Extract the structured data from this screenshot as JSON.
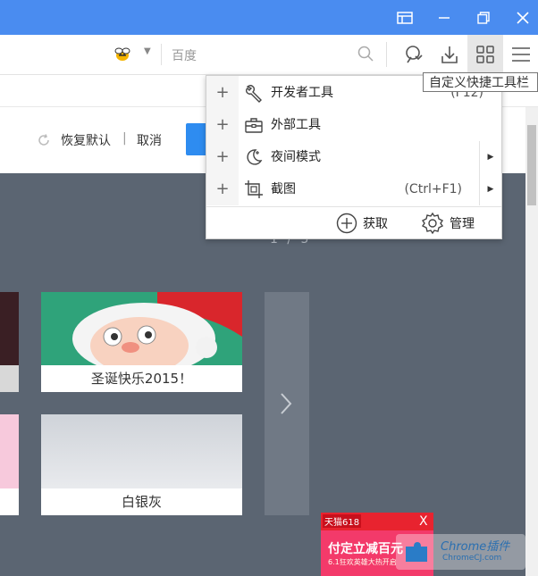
{
  "colors": {
    "titlebar": "#4a8cf0",
    "page_bg": "#5b6572",
    "accent_button": "#2e8cf0",
    "ad_red": "#e8232f"
  },
  "search": {
    "placeholder": "百度"
  },
  "toolbar": {
    "customize_tooltip": "自定义快捷工具栏"
  },
  "settings_panel": {
    "restore_default": "恢复默认",
    "separator": "|",
    "cancel": "取消"
  },
  "gallery": {
    "pager": "1 / 5",
    "themes": [
      {
        "caption": "圣诞快乐2015！"
      },
      {
        "caption": "白银灰"
      }
    ]
  },
  "menu": {
    "items": [
      {
        "label": "开发者工具",
        "shortcut": "(F12)",
        "icon": "wrench-icon",
        "submenu": false
      },
      {
        "label": "外部工具",
        "shortcut": "",
        "icon": "toolbox-icon",
        "submenu": false
      },
      {
        "label": "夜间模式",
        "shortcut": "",
        "icon": "moon-icon",
        "submenu": true
      },
      {
        "label": "截图",
        "shortcut": "(Ctrl+F1)",
        "icon": "crop-icon",
        "submenu": true
      }
    ],
    "footer": {
      "get": "获取",
      "manage": "管理"
    }
  },
  "ad": {
    "brand": "天猫618",
    "headline": "付定立减百元",
    "sub": "6.1狂欢英雄大热开启",
    "close": "X"
  },
  "watermark": {
    "title": "Chrome插件",
    "url": "ChromeCJ.com"
  }
}
